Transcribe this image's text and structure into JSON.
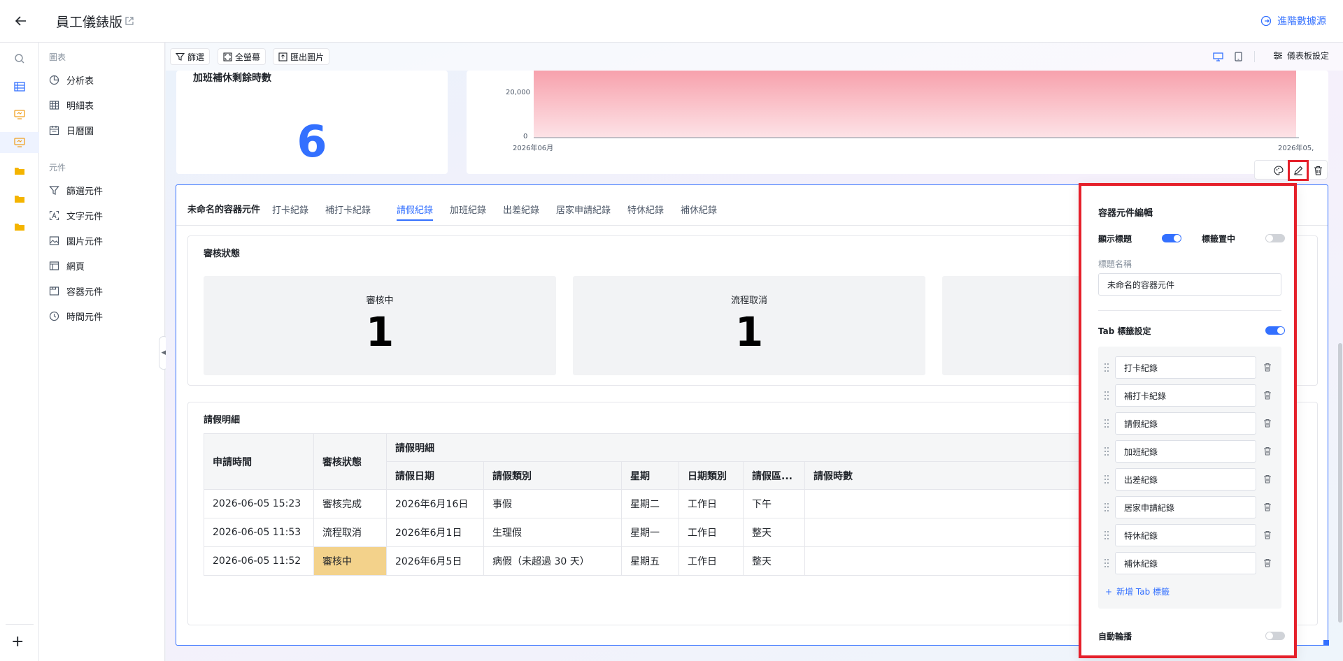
{
  "app": {
    "title": "員工儀錶版",
    "advanced_source": "進階數據源"
  },
  "panel": {
    "charts_group": "圖表",
    "charts": [
      {
        "label": "分析表",
        "icon": "pie-icon"
      },
      {
        "label": "明細表",
        "icon": "table-icon"
      },
      {
        "label": "日曆圖",
        "icon": "calendar-icon"
      }
    ],
    "elements_group": "元件",
    "elements": [
      {
        "label": "篩選元件",
        "icon": "filter-icon"
      },
      {
        "label": "文字元件",
        "icon": "text-icon"
      },
      {
        "label": "圖片元件",
        "icon": "image-icon"
      },
      {
        "label": "網頁",
        "icon": "webpage-icon"
      },
      {
        "label": "容器元件",
        "icon": "container-icon"
      },
      {
        "label": "時間元件",
        "icon": "clock-icon"
      }
    ]
  },
  "toolbar": {
    "filter": "篩選",
    "fullscreen": "全螢幕",
    "export": "匯出圖片",
    "dashboard_settings": "儀表板設定"
  },
  "metric": {
    "title": "加班補休剩餘時數",
    "value": "6"
  },
  "chart_data": {
    "type": "area",
    "x_ticks": [
      "2026年06月",
      "2026年05,"
    ],
    "y_ticks": [
      "20,000",
      "0"
    ],
    "fill_color": "#f7a1ac"
  },
  "container": {
    "title": "未命名的容器元件",
    "tabs": [
      "打卡紀錄",
      "補打卡紀錄",
      "請假紀錄",
      "加班紀錄",
      "出差紀錄",
      "居家申請紀錄",
      "特休紀錄",
      "補休紀錄"
    ],
    "active_tab": 2,
    "status_card": {
      "title": "審核狀態",
      "stats": [
        {
          "label": "審核中",
          "value": "1"
        },
        {
          "label": "流程取消",
          "value": "1"
        }
      ]
    },
    "detail_card": {
      "title": "請假明細",
      "col_time": "申請時間",
      "col_status": "審核狀態",
      "group_header": "請假明細",
      "sub_columns": [
        "請假日期",
        "請假類別",
        "星期",
        "日期類別",
        "請假區...",
        "請假時數"
      ],
      "rows": [
        {
          "time": "2026-06-05 15:23",
          "status": "審核完成",
          "date": "2026年6月16日",
          "type": "事假",
          "weekday": "星期二",
          "day_type": "工作日",
          "range": "下午",
          "hours": ""
        },
        {
          "time": "2026-06-05 11:53",
          "status": "流程取消",
          "date": "2026年6月1日",
          "type": "生理假",
          "weekday": "星期一",
          "day_type": "工作日",
          "range": "整天",
          "hours": ""
        },
        {
          "time": "2026-06-05 11:52",
          "status": "審核中",
          "date": "2026年6月5日",
          "type": "病假（未超過 30 天）",
          "weekday": "星期五",
          "day_type": "工作日",
          "range": "整天",
          "hours": ""
        }
      ]
    }
  },
  "editor": {
    "title": "容器元件編輯",
    "show_title_label": "顯示標題",
    "show_title_on": true,
    "center_tabs_label": "標籤置中",
    "center_tabs_on": false,
    "title_name_label": "標題名稱",
    "title_name_value": "未命名的容器元件",
    "tab_settings_label": "Tab 標籤設定",
    "tab_settings_on": true,
    "tab_items": [
      "打卡紀錄",
      "補打卡紀錄",
      "請假紀錄",
      "加班紀錄",
      "出差紀錄",
      "居家申請紀錄",
      "特休紀錄",
      "補休紀錄"
    ],
    "add_tab": "新增 Tab 標籤",
    "autoplay_label": "自動輪播",
    "autoplay_on": false
  },
  "colors": {
    "accent": "#3370ff",
    "highlight": "#e5202b",
    "pending": "#f3d28b"
  }
}
